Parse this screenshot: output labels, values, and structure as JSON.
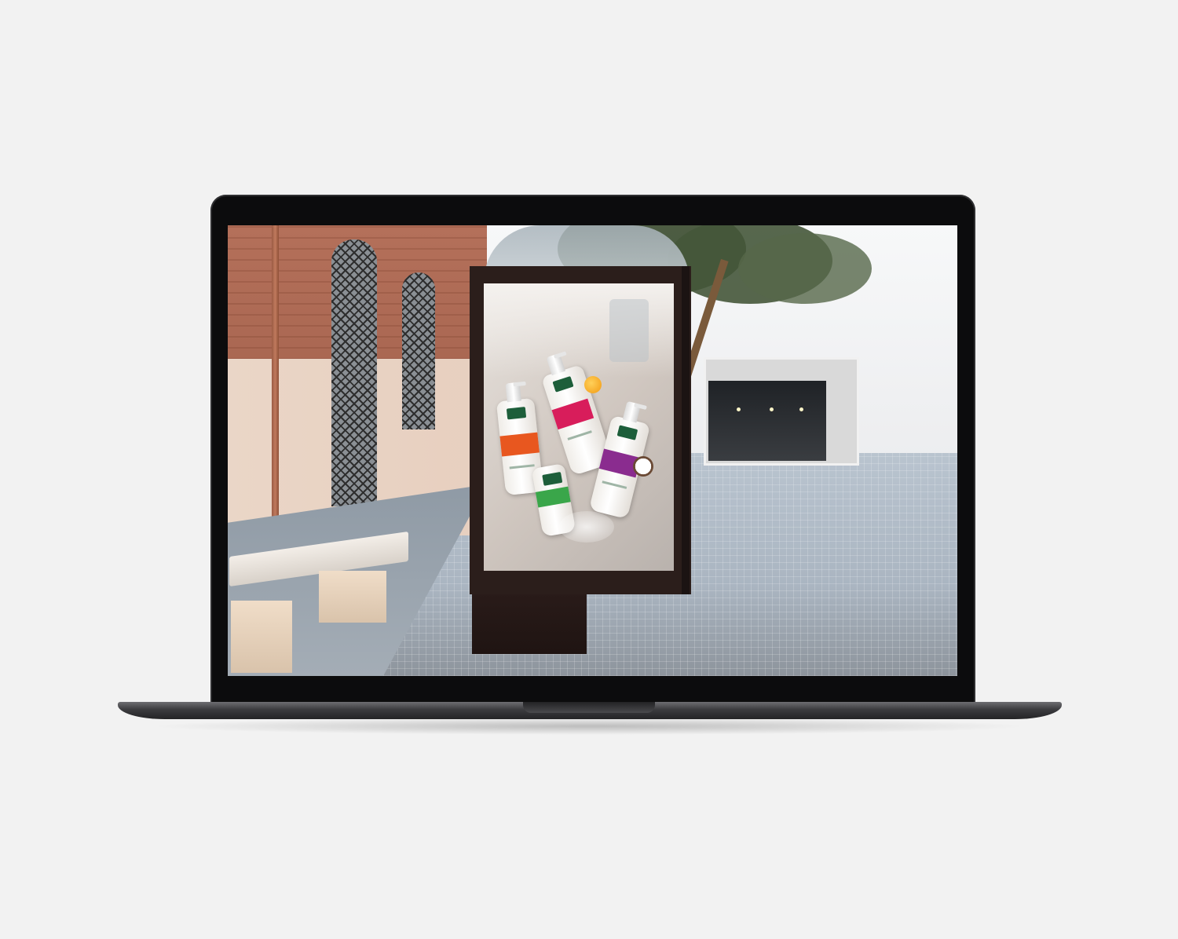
{
  "page": {
    "background": "#f2f2f2"
  },
  "device": {
    "type": "laptop",
    "lid_color": "#0c0c0d",
    "base_color": "#3b3b3e"
  },
  "scene": {
    "subject": "street-billboard-mockup",
    "billboard": {
      "bottles": [
        {
          "band_color": "#e8571f"
        },
        {
          "band_color": "#d81d5b"
        },
        {
          "band_color": "#3aa64a"
        },
        {
          "band_color": "#8a2c8f"
        }
      ]
    }
  }
}
